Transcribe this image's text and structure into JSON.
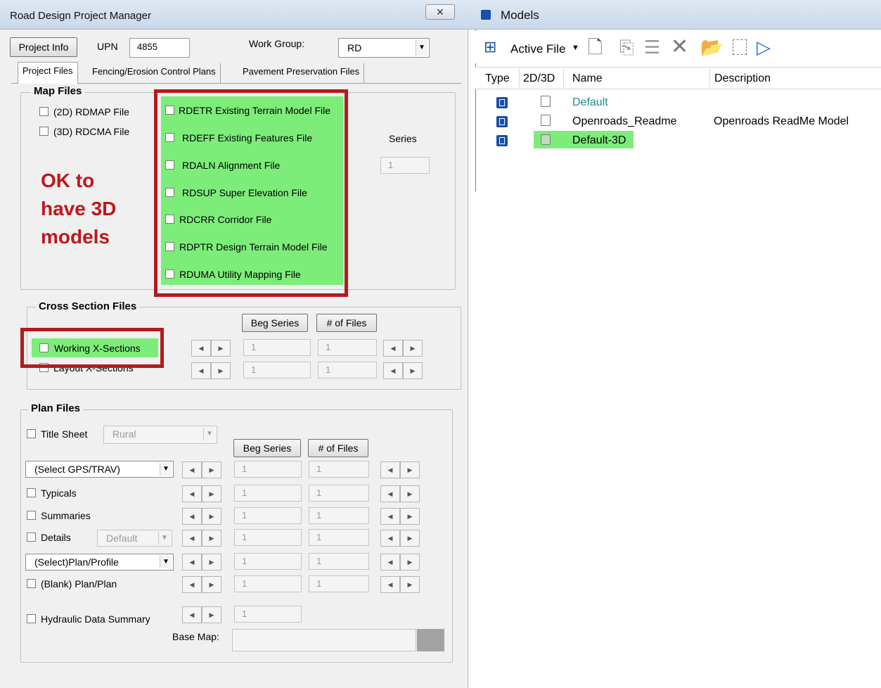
{
  "left_window": {
    "title": "Road Design Project Manager",
    "close": "✕",
    "project_info_button": "Project Info",
    "upn_label": "UPN",
    "upn_value": "4855",
    "work_group_label": "Work Group:",
    "work_group_value": "RD",
    "tabs": [
      {
        "label": "Project Files",
        "active": true
      },
      {
        "label": "Fencing/Erosion Control Plans",
        "active": false
      },
      {
        "label": "Pavement Preservation Files",
        "active": false
      }
    ],
    "map_files": {
      "legend": "Map Files",
      "left_items": [
        "(2D)  RDMAP File",
        "(3D)  RDCMA  File"
      ],
      "highlighted_items": [
        "RDETR Existing Terrain Model File",
        "RDEFF Existing Features File",
        "RDALN Alignment File",
        "RDSUP Super Elevation File",
        "RDCRR Corridor File",
        "RDPTR Design Terrain Model File",
        "RDUMA Utility Mapping File"
      ],
      "series_label": "Series",
      "series_value": "1",
      "annotation_lines": [
        "OK to",
        "have 3D",
        "models"
      ]
    },
    "cross_section_files": {
      "legend": "Cross Section Files",
      "beg_series_button": "Beg Series",
      "num_files_button": "# of Files",
      "rows": [
        {
          "label": "Working X-Sections",
          "beg": "1",
          "count": "1"
        },
        {
          "label": "Layout X-Sections",
          "beg": "1",
          "count": "1"
        }
      ]
    },
    "plan_files": {
      "legend": "Plan Files",
      "title_sheet_label": "Title Sheet",
      "title_sheet_combo": "Rural",
      "beg_series_button": "Beg Series",
      "num_files_button": "# of Files",
      "gps_combo": "(Select GPS/TRAV)",
      "typicals": "Typicals",
      "summaries": "Summaries",
      "details": "Details",
      "details_combo": "Default",
      "plan_profile_combo": "(Select)Plan/Profile",
      "blank_plan": "(Blank) Plan/Plan",
      "hydraulic": "Hydraulic Data Summary",
      "base_map_label": "Base Map:",
      "rows": [
        {
          "beg": "1",
          "count": "1"
        },
        {
          "beg": "1",
          "count": "1"
        },
        {
          "beg": "1",
          "count": "1"
        },
        {
          "beg": "1",
          "count": "1"
        },
        {
          "beg": "1",
          "count": "1"
        },
        {
          "beg": "1",
          "count": "1"
        },
        {
          "beg": "1"
        }
      ]
    }
  },
  "right_window": {
    "title": "Models",
    "active_file_label": "Active File",
    "columns": [
      "Type",
      "2D/3D",
      "Name",
      "Description"
    ],
    "models": [
      {
        "name": "Default",
        "description": "",
        "dim": "2D",
        "name_color": "#1a8a8a"
      },
      {
        "name": "Openroads_Readme",
        "description": "Openroads ReadMe Model",
        "dim": "2D"
      },
      {
        "name": "Default-3D",
        "description": "",
        "dim": "3D",
        "highlight": "#7ded7a"
      }
    ]
  },
  "colors": {
    "highlight_green": "#7ded7a",
    "annotation_red": "#c0161b",
    "box_red": "#b31b1b"
  }
}
